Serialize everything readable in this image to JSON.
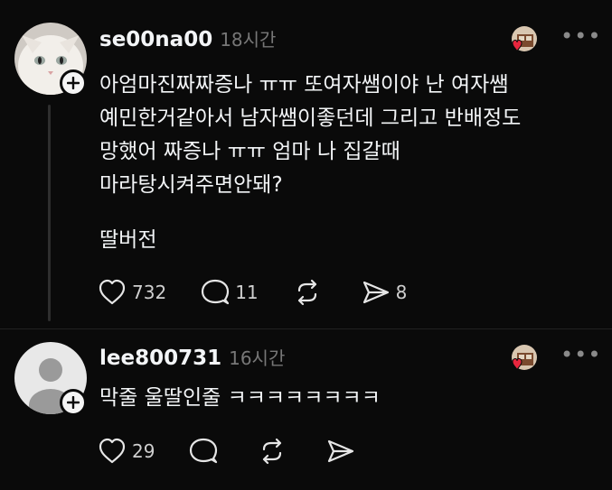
{
  "posts": [
    {
      "username": "se00na00",
      "time": "18시간",
      "text": "아엄마진짜짜증나 ㅠㅠ 또여자쌤이야 난 여자쌤\n예민한거같아서 남자쌤이좋던데 그리고 반배정도\n망했어 짜증나 ㅠㅠ 엄마 나 집갈때\n마라탕시켜주면안돼?",
      "text2": "딸버전",
      "likes": "732",
      "replies": "11",
      "reposts": "",
      "shares": "8",
      "avatar": "white-cat-avatar"
    },
    {
      "username": "lee800731",
      "time": "16시간",
      "text": "막줄 울딸인줄 ㅋㅋㅋㅋㅋㅋㅋㅋ",
      "likes": "29",
      "replies": "",
      "reposts": "",
      "shares": "",
      "avatar": "default-person-avatar"
    }
  ],
  "more_label": "•••",
  "colors": {
    "background": "#0a0a0a",
    "text": "#f3f5f7",
    "muted": "#777777",
    "heart": "#e8263e"
  }
}
